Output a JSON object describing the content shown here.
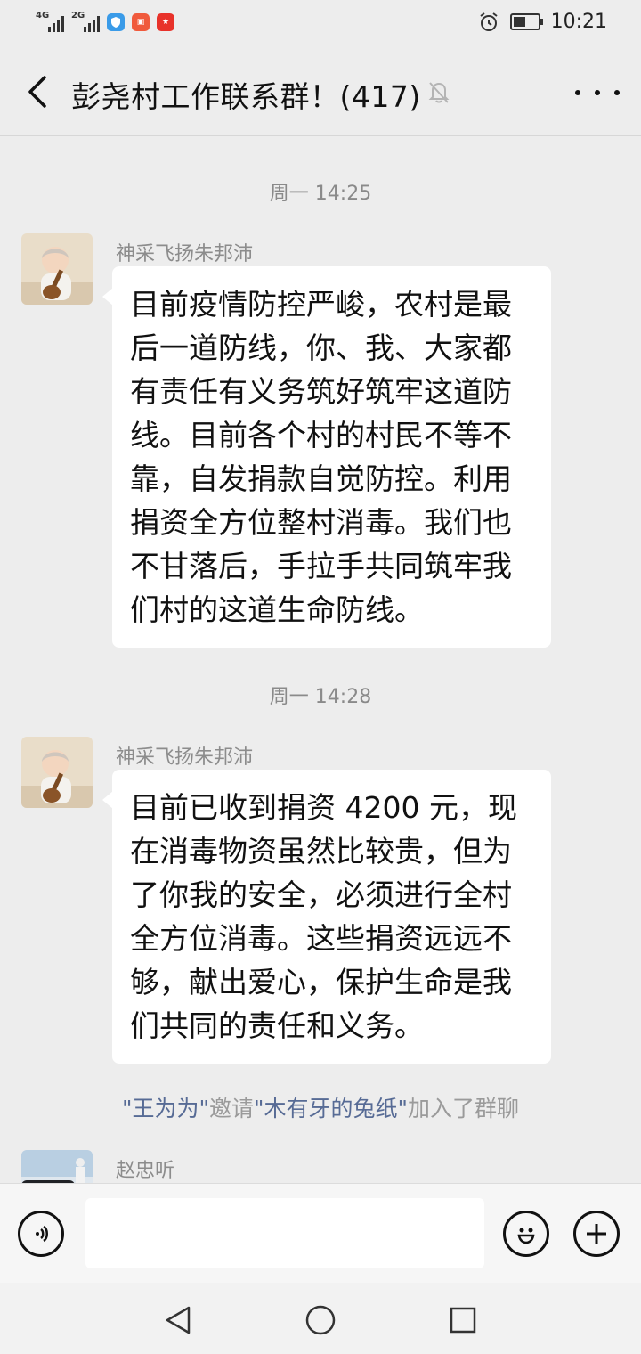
{
  "status_bar": {
    "network1": "4G",
    "network2": "2G",
    "time": "10:21",
    "battery_level": 0.55
  },
  "header": {
    "title": "彭尧村工作联系群！(417)",
    "back_icon": "chevron-left-icon",
    "mute_icon": "bell-muted-icon",
    "more_icon": "more-dots-icon"
  },
  "messages": [
    {
      "timestamp": "周一 14:25",
      "sender": "神采飞扬朱邦沛",
      "text": "目前疫情防控严峻，农村是最后一道防线，你、我、大家都有责任有义务筑好筑牢这道防线。目前各个村的村民不等不靠，自发捐款自觉防控。利用捐资全方位整村消毒。我们也不甘落后，手拉手共同筑牢我们村的这道生命防线。"
    },
    {
      "timestamp": "周一 14:28",
      "sender": "神采飞扬朱邦沛",
      "text": "目前已收到捐资 4200 元，现在消毒物资虽然比较贵，但为了你我的安全，必须进行全村全方位消毒。这些捐资远远不够，献出爱心，保护生命是我们共同的责任和义务。"
    }
  ],
  "system_notice": {
    "inviter": "\"王为为\"",
    "mid": "邀请",
    "invitee": "\"木有牙的兔纸\"",
    "tail": "加入了群聊"
  },
  "last_sender": "赵忠听",
  "input_bar": {
    "voice_icon": "voice-icon",
    "emoji_icon": "emoji-icon",
    "plus_icon": "plus-icon",
    "value": ""
  },
  "nav": {
    "back": "triangle-back-icon",
    "home": "circle-home-icon",
    "recent": "square-recent-icon"
  }
}
